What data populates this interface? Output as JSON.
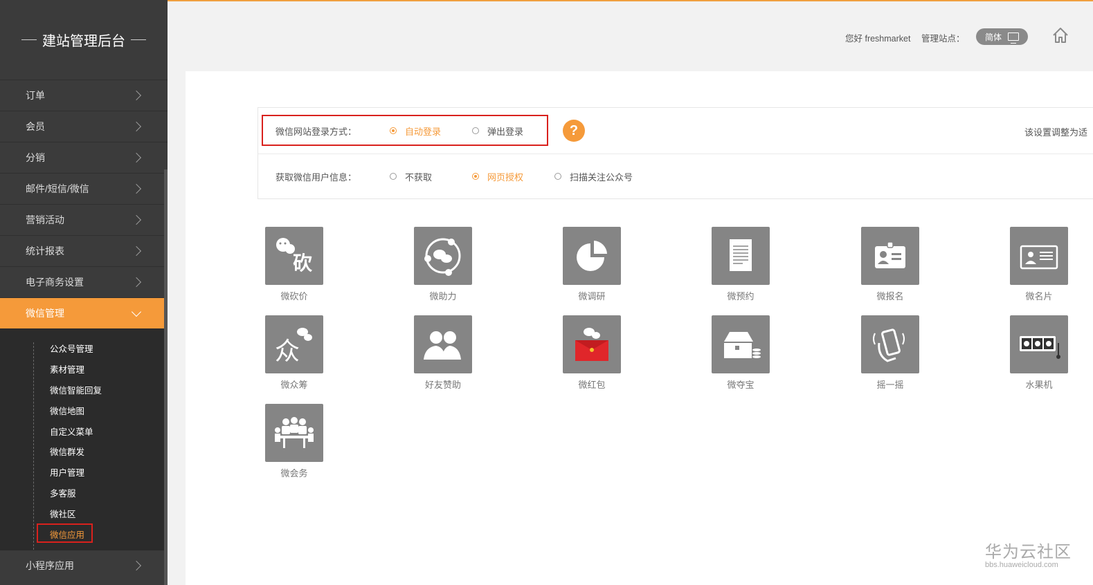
{
  "sidebar": {
    "brand": "建站管理后台",
    "menu": [
      {
        "label": "订单"
      },
      {
        "label": "会员"
      },
      {
        "label": "分销"
      },
      {
        "label": "邮件/短信/微信"
      },
      {
        "label": "营销活动"
      },
      {
        "label": "统计报表"
      },
      {
        "label": "电子商务设置"
      },
      {
        "label": "微信管理"
      }
    ],
    "submenu": [
      {
        "label": "公众号管理"
      },
      {
        "label": "素材管理"
      },
      {
        "label": "微信智能回复"
      },
      {
        "label": "微信地图"
      },
      {
        "label": "自定义菜单"
      },
      {
        "label": "微信群发"
      },
      {
        "label": "用户管理"
      },
      {
        "label": "多客服"
      },
      {
        "label": "微社区"
      },
      {
        "label": "微信应用"
      }
    ],
    "bottom_item": "小程序应用",
    "active_menu": "微信管理",
    "active_submenu": "微信应用"
  },
  "header": {
    "greeting": "您好 freshmarket",
    "site_label": "管理站点：",
    "language": "简体"
  },
  "settings": {
    "login_mode": {
      "label": "微信网站登录方式：",
      "options": [
        "自动登录",
        "弹出登录"
      ],
      "selected": "自动登录"
    },
    "user_info": {
      "label": "获取微信用户信息：",
      "options": [
        "不获取",
        "网页授权",
        "扫描关注公众号"
      ],
      "selected": "网页授权"
    },
    "note": "该设置调整为适"
  },
  "apps": [
    {
      "name": "微砍价",
      "icon": "bargain-icon"
    },
    {
      "name": "微助力",
      "icon": "assist-icon"
    },
    {
      "name": "微调研",
      "icon": "survey-icon"
    },
    {
      "name": "微预约",
      "icon": "reservation-icon"
    },
    {
      "name": "微报名",
      "icon": "signup-icon"
    },
    {
      "name": "微名片",
      "icon": "business-card-icon"
    },
    {
      "name": "微众筹",
      "icon": "crowdfunding-icon"
    },
    {
      "name": "好友赞助",
      "icon": "friend-sponsor-icon"
    },
    {
      "name": "微红包",
      "icon": "red-packet-icon"
    },
    {
      "name": "微夺宝",
      "icon": "treasure-icon"
    },
    {
      "name": "摇一摇",
      "icon": "shake-icon"
    },
    {
      "name": "水果机",
      "icon": "slot-machine-icon"
    },
    {
      "name": "微会务",
      "icon": "conference-icon"
    }
  ],
  "watermark": {
    "title": "华为云社区",
    "url": "bbs.huaweicloud.com"
  },
  "colors": {
    "accent": "#f59a3a",
    "highlight_box": "#d9211d",
    "sidebar_bg": "#3b3b3b",
    "tile_bg": "#858585"
  }
}
